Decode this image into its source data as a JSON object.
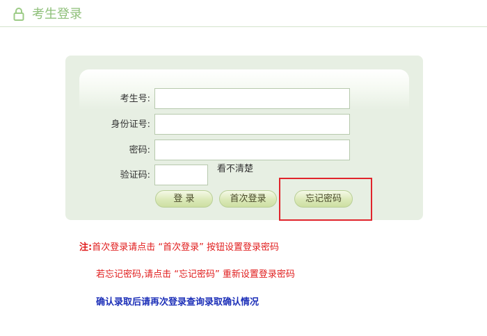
{
  "header": {
    "title": "考生登录",
    "icon": "lock-icon",
    "accent_color": "#8fc07a"
  },
  "form": {
    "exam_no_label": "考生号:",
    "exam_no_value": "",
    "id_card_label": "身份证号:",
    "id_card_value": "",
    "password_label": "密码:",
    "password_value": "",
    "captcha_label": "验证码:",
    "captcha_value": "",
    "captcha_hint": "看不清楚"
  },
  "buttons": {
    "login": "登 录",
    "first_login": "首次登录",
    "forgot_password": "忘记密码"
  },
  "notes": {
    "prefix": "注:",
    "line1": "首次登录请点击 “首次登录” 按钮设置登录密码",
    "line2": "若忘记密码,请点击 “忘记密码” 重新设置登录密码",
    "line3": "确认录取后请再次登录查询录取确认情况",
    "red_color": "#e01c1c",
    "blue_color": "#1c2fb8"
  }
}
